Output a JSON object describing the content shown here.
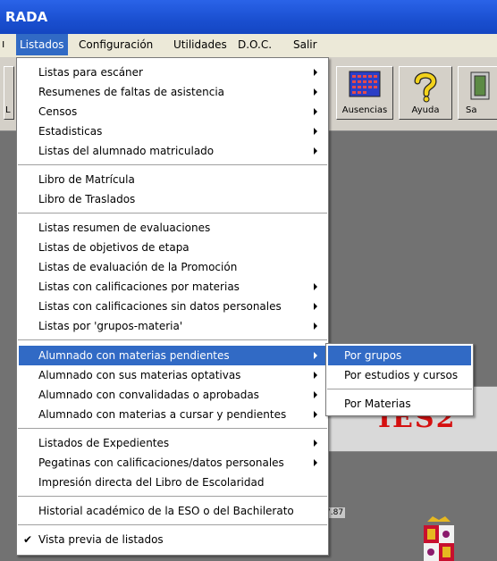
{
  "window": {
    "title": "RADA"
  },
  "menubar": {
    "items": [
      {
        "label": "Listados"
      },
      {
        "label": "Configuración"
      },
      {
        "label": "Utilidades"
      },
      {
        "label": "D.O.C."
      },
      {
        "label": "Salir"
      }
    ]
  },
  "toolbar": {
    "buttons": [
      {
        "label": "Ausencias",
        "icon": "calendar-grid-icon"
      },
      {
        "label": "Ayuda",
        "icon": "question-mark-icon"
      },
      {
        "label": "Sa",
        "icon": "exit-door-icon"
      }
    ]
  },
  "content": {
    "logo_text": "IES2",
    "version_text": "7.87"
  },
  "listados_menu": {
    "items": [
      {
        "label": "Listas para escáner",
        "submenu": true
      },
      {
        "label": "Resumenes de faltas de asistencia",
        "submenu": true
      },
      {
        "label": "Censos",
        "submenu": true
      },
      {
        "label": "Estadisticas",
        "submenu": true
      },
      {
        "label": "Listas del alumnado matriculado",
        "submenu": true
      },
      {
        "label": "Libro de Matrícula",
        "submenu": false
      },
      {
        "label": "Libro de Traslados",
        "submenu": false
      },
      {
        "label": "Listas resumen de evaluaciones",
        "submenu": false
      },
      {
        "label": "Listas de objetivos de etapa",
        "submenu": false
      },
      {
        "label": "Listas de evaluación de la Promoción",
        "submenu": false
      },
      {
        "label": "Listas con calificaciones por materias",
        "submenu": true
      },
      {
        "label": "Listas con calificaciones sin datos personales",
        "submenu": true
      },
      {
        "label": "Listas por 'grupos-materia'",
        "submenu": true
      },
      {
        "label": "Alumnado con materias pendientes",
        "submenu": true,
        "highlighted": true
      },
      {
        "label": "Alumnado con sus materias optativas",
        "submenu": true
      },
      {
        "label": "Alumnado con convalidadas o aprobadas",
        "submenu": true
      },
      {
        "label": "Alumnado con materias a cursar y pendientes",
        "submenu": true
      },
      {
        "label": "Listados de Expedientes",
        "submenu": true
      },
      {
        "label": "Pegatinas con calificaciones/datos personales",
        "submenu": true
      },
      {
        "label": "Impresión directa del Libro de Escolaridad",
        "submenu": false
      },
      {
        "label": "Historial académico de la ESO o del Bachilerato",
        "submenu": false
      },
      {
        "label": "Vista previa de listados",
        "submenu": false,
        "checked": true
      }
    ]
  },
  "submenu": {
    "items": [
      {
        "label": "Por grupos",
        "highlighted": true
      },
      {
        "label": "Por estudios y cursos"
      },
      {
        "label": "Por Materias"
      }
    ]
  },
  "colors": {
    "highlight": "#316ac5",
    "titlebar": "#1a4fd0",
    "logo_red": "#d51010"
  }
}
